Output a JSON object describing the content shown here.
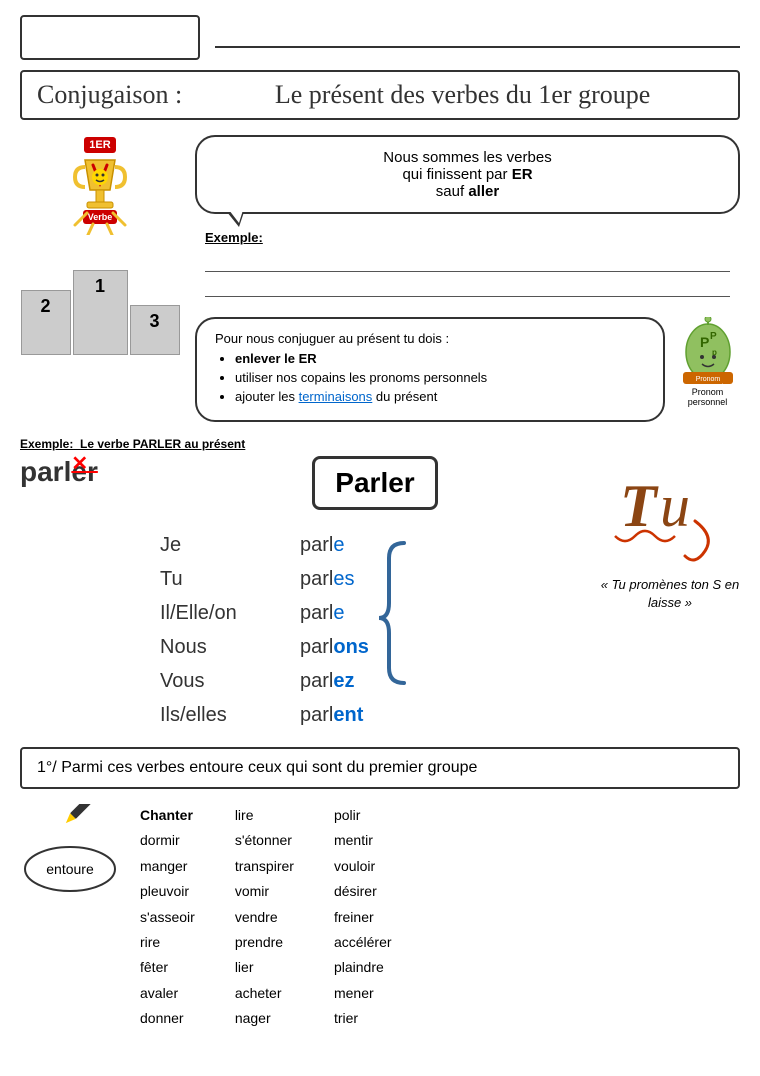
{
  "top": {
    "name_placeholder": "",
    "line": ""
  },
  "title": {
    "label": "Conjugaison :",
    "main": "Le présent des verbes du 1er groupe"
  },
  "speech1": {
    "text1": "Nous sommes les verbes",
    "text2": "qui finissent par ",
    "bold": "ER",
    "text3": "sauf ",
    "bold2": "aller"
  },
  "exemple": {
    "title": "Exemple:"
  },
  "speech2": {
    "intro": "Pour nous conjuguer au présent tu dois :",
    "bullet1": "enlever le ER",
    "bullet2": "utiliser nos copains les pronoms personnels",
    "bullet3_pre": "ajouter les ",
    "bullet3_link": "terminaisons",
    "bullet3_post": " du présent"
  },
  "podium": {
    "badge": "1ER",
    "label": "Verbe",
    "pos1": "1",
    "pos2": "2",
    "pos3": "3"
  },
  "parler": {
    "example_label": "Exemple:  Le verbe PARLER au présent",
    "title": "Parler",
    "crossed_word": "parler",
    "rows": [
      {
        "pronoun": "Je",
        "stem": "parl",
        "ending": "e",
        "class": "ending-e"
      },
      {
        "pronoun": "Tu",
        "stem": "parl",
        "ending": "es",
        "class": "ending-es"
      },
      {
        "pronoun": "Il/Elle/on",
        "stem": "parl",
        "ending": "e",
        "class": "ending-e"
      },
      {
        "pronoun": "Nous",
        "stem": "parl",
        "ending": "ons",
        "class": "ending-ons"
      },
      {
        "pronoun": "Vous",
        "stem": "parl",
        "ending": "ez",
        "class": "ending-ez"
      },
      {
        "pronoun": "Ils/elles",
        "stem": "parl",
        "ending": "ent",
        "class": "ending-ent"
      }
    ],
    "tu_quote": "« Tu promènes ton S en laisse »"
  },
  "exercise": {
    "label": "1°/ Parmi ces verbes entoure ceux qui sont du premier groupe",
    "col1": [
      "Chanter",
      "dormir",
      "manger",
      "pleuvoir",
      "s'asseoir",
      "rire",
      "fêter",
      "avaler",
      "donner"
    ],
    "col1_bold": [
      true,
      false,
      false,
      false,
      false,
      false,
      false,
      false,
      false
    ],
    "col2": [
      "lire",
      "s'étonner",
      "transpirer",
      "vomir",
      "vendre",
      "prendre",
      "lier",
      "acheter",
      "nager"
    ],
    "col2_bold": [
      false,
      false,
      false,
      false,
      false,
      false,
      false,
      false,
      false
    ],
    "col3": [
      "polir",
      "mentir",
      "vouloir",
      "désirer",
      "freiner",
      "accélérer",
      "plaindre",
      "mener",
      "trier"
    ],
    "col3_bold": [
      false,
      false,
      false,
      false,
      false,
      false,
      false,
      false,
      false
    ]
  }
}
